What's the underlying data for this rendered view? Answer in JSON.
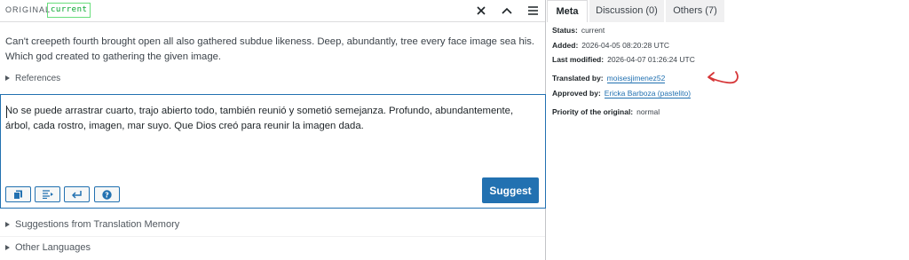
{
  "original_panel": {
    "label": "ORIGINAL",
    "badge": "current",
    "text": "Can't creepeth fourth brought open all also gathered subdue likeness. Deep, abundantly, tree every face image sea his. Which god created to gathering the given image.",
    "references_label": "References"
  },
  "editor": {
    "translation_text": "No se puede arrastrar cuarto, trajo abierto todo, también reunió y sometió semejanza. Profundo, abundantemente, árbol, cada rostro, imagen, mar suyo. Que Dios creó para reunir la imagen dada.",
    "suggest_label": "Suggest",
    "help_glyph": "?"
  },
  "sections": {
    "translation_memory": "Suggestions from Translation Memory",
    "other_languages": "Other Languages"
  },
  "tabs": [
    {
      "label": "Meta"
    },
    {
      "label": "Discussion (0)"
    },
    {
      "label": "Others (7)"
    }
  ],
  "meta": {
    "status_key": "Status:",
    "status_val": "current",
    "added_key": "Added:",
    "added_val": "2026-04-05 08:20:28 UTC",
    "modified_key": "Last modified:",
    "modified_val": "2026-04-07 01:26:24 UTC",
    "translated_key": "Translated by:",
    "translated_val": "moisesjimenez52",
    "approved_key": "Approved by:",
    "approved_val": "Ericka Barboza (pastelito)",
    "priority_key": "Priority of the original:",
    "priority_val": "normal"
  },
  "colors": {
    "accent": "#2271b1",
    "badge_green": "#00a32a",
    "annotation_red": "#d63638"
  }
}
